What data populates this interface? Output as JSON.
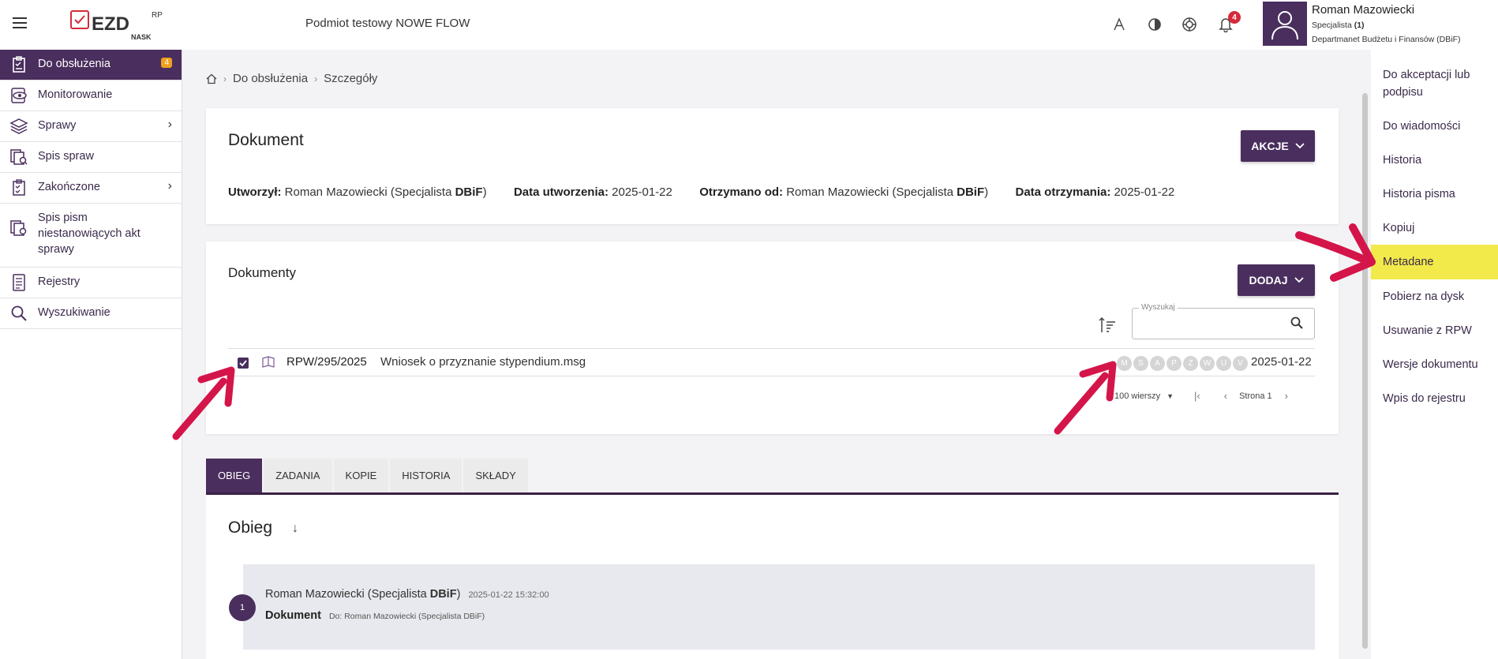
{
  "header": {
    "org_title": "Podmiot testowy NOWE FLOW",
    "logo_text": "EZD",
    "logo_sup": "RP",
    "logo_sub": "NASK",
    "notification_count": "4",
    "user": {
      "name": "Roman Mazowiecki",
      "role": "Specjalista",
      "role_count": "(1)",
      "department": "Departmanet Budżetu i Finansów (DBiF)"
    }
  },
  "sidebar": {
    "items": [
      {
        "label": "Do obsłużenia",
        "badge": "4",
        "icon": "clipboard-icon"
      },
      {
        "label": "Monitorowanie",
        "icon": "eye-icon"
      },
      {
        "label": "Sprawy",
        "icon": "layers-icon"
      },
      {
        "label": "Spis spraw",
        "icon": "docs-search-icon"
      },
      {
        "label": "Zakończone",
        "icon": "clipboard-check-icon"
      },
      {
        "label": "Spis pism niestanowiących akt sprawy",
        "icon": "docs-gear-icon"
      },
      {
        "label": "Rejestry",
        "icon": "register-icon"
      },
      {
        "label": "Wyszukiwanie",
        "icon": "search-icon"
      }
    ]
  },
  "breadcrumb": {
    "items": [
      "Do obsłużenia",
      "Szczegóły"
    ]
  },
  "document_card": {
    "title": "Dokument",
    "action_label": "AKCJE",
    "created_by_label": "Utworzył:",
    "created_by_value": "Roman Mazowiecki (Specjalista ",
    "created_by_bold": "DBiF",
    "created_date_label": "Data utworzenia:",
    "created_date_value": "2025-01-22",
    "received_from_label": "Otrzymano od:",
    "received_from_value": "Roman Mazowiecki (Specjalista ",
    "received_from_bold": "DBiF",
    "received_date_label": "Data otrzymania:",
    "received_date_value": "2025-01-22",
    "close_paren": ")"
  },
  "documents_card": {
    "title": "Dokumenty",
    "add_label": "DODAJ",
    "search_label": "Wyszukaj",
    "row": {
      "signature": "RPW/295/2025",
      "name": "Wniosek o przyznanie stypendium.msg",
      "status_letters": [
        "M",
        "S",
        "A",
        "P",
        "Z",
        "W",
        "U",
        "V"
      ],
      "date": "2025-01-22"
    },
    "pager": {
      "rows_label": "100 wierszy",
      "page_label": "Strona 1"
    }
  },
  "tabs": [
    "OBIEG",
    "ZADANIA",
    "KOPIE",
    "HISTORIA",
    "SKŁADY"
  ],
  "obieg": {
    "title": "Obieg",
    "entry": {
      "number": "1",
      "author": "Roman Mazowiecki (Specjalista ",
      "author_bold": "DBiF",
      "timestamp": "2025-01-22 15:32:00",
      "doc_label": "Dokument",
      "to": "Do: Roman Mazowiecki (Specjalista DBiF)"
    }
  },
  "right_menu": {
    "items": [
      "Do akceptacji lub podpisu",
      "Do wiadomości",
      "Historia",
      "Historia pisma",
      "Kopiuj",
      "Metadane",
      "Pobierz na dysk",
      "Usuwanie z RPW",
      "Wersje dokumentu",
      "Wpis do rejestru"
    ],
    "highlight_color": "#f2ea4a"
  },
  "colors": {
    "brand": "#4a2e5e",
    "arrow": "#d4154a",
    "badge": "#f0a020",
    "notification": "#d42a3a"
  }
}
